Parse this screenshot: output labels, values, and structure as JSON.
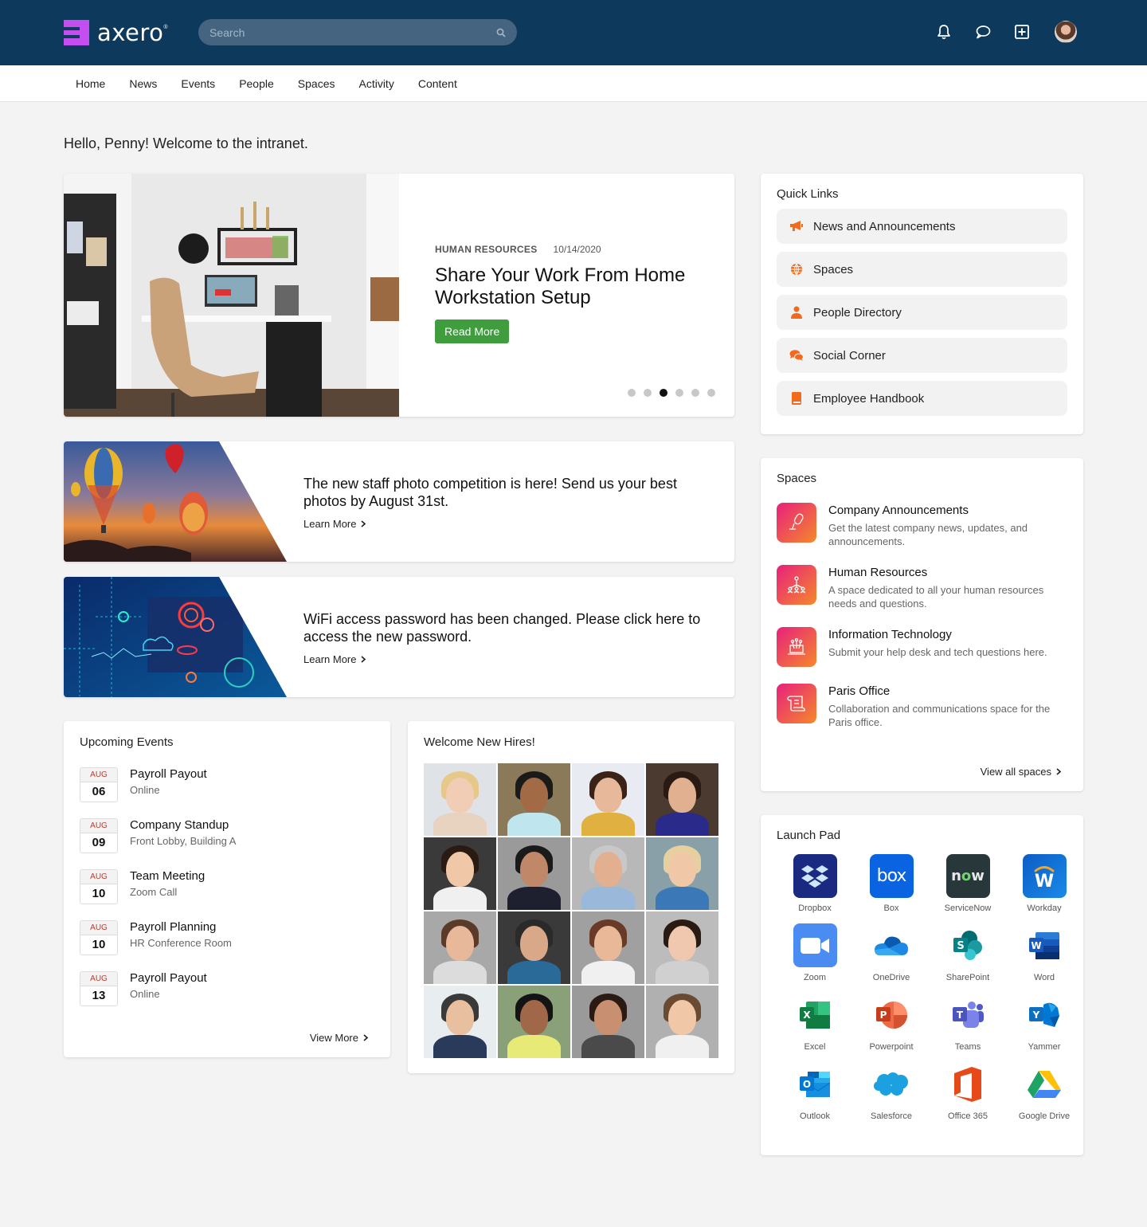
{
  "app": {
    "logo_text": "axero",
    "brand_color": "#c54ef0",
    "header_color": "#0d3a5c"
  },
  "search": {
    "placeholder": "Search",
    "value": ""
  },
  "header_icons": [
    "bell-icon",
    "chat-icon",
    "add-icon",
    "avatar"
  ],
  "nav": [
    {
      "label": "Home"
    },
    {
      "label": "News"
    },
    {
      "label": "Events"
    },
    {
      "label": "People"
    },
    {
      "label": "Spaces"
    },
    {
      "label": "Activity"
    },
    {
      "label": "Content"
    }
  ],
  "greeting": "Hello, Penny! Welcome to the intranet.",
  "hero": {
    "category": "HUMAN RESOURCES",
    "date": "10/14/2020",
    "title": "Share Your Work From Home Workstation Setup",
    "button": "Read More",
    "slide_count": 6,
    "active_slide": 3
  },
  "banners": [
    {
      "title": "The new staff photo competition is here! Send us your best photos by August 31st.",
      "link": "Learn More"
    },
    {
      "title": "WiFi access password has been changed. Please click here to access the new password.",
      "link": "Learn More"
    }
  ],
  "events": {
    "title": "Upcoming Events",
    "items": [
      {
        "month": "AUG",
        "day": "06",
        "title": "Payroll Payout",
        "location": "Online"
      },
      {
        "month": "AUG",
        "day": "09",
        "title": "Company Standup",
        "location": "Front Lobby, Building A"
      },
      {
        "month": "AUG",
        "day": "10",
        "title": "Team Meeting",
        "location": "Zoom Call"
      },
      {
        "month": "AUG",
        "day": "10",
        "title": "Payroll Planning",
        "location": "HR Conference Room"
      },
      {
        "month": "AUG",
        "day": "13",
        "title": "Payroll Payout",
        "location": "Online"
      }
    ],
    "view_more": "View More"
  },
  "new_hires": {
    "title": "Welcome New Hires!",
    "photo_count": 16
  },
  "quick_links": {
    "title": "Quick Links",
    "accent": "#f26b1d",
    "items": [
      {
        "label": "News and Announcements",
        "icon": "megaphone-icon"
      },
      {
        "label": "Spaces",
        "icon": "globe-icon"
      },
      {
        "label": "People Directory",
        "icon": "person-icon"
      },
      {
        "label": "Social Corner",
        "icon": "comments-icon"
      },
      {
        "label": "Employee Handbook",
        "icon": "book-icon"
      }
    ]
  },
  "spaces": {
    "title": "Spaces",
    "items": [
      {
        "name": "Company Announcements",
        "desc": "Get the latest company news, updates, and announcements.",
        "icon": "microphone-icon"
      },
      {
        "name": "Human Resources",
        "desc": "A space dedicated to all your human resources needs and questions.",
        "icon": "org-chart-icon"
      },
      {
        "name": "Information Technology",
        "desc": "Submit your help desk and tech questions here.",
        "icon": "laptop-icon"
      },
      {
        "name": "Paris Office",
        "desc": "Collaboration and communications space for the Paris office.",
        "icon": "scroll-icon"
      }
    ],
    "view_all": "View all spaces"
  },
  "launch_pad": {
    "title": "Launch Pad",
    "apps": [
      {
        "label": "Dropbox"
      },
      {
        "label": "Box"
      },
      {
        "label": "ServiceNow"
      },
      {
        "label": "Workday"
      },
      {
        "label": "Zoom"
      },
      {
        "label": "OneDrive"
      },
      {
        "label": "SharePoint"
      },
      {
        "label": "Word"
      },
      {
        "label": "Excel"
      },
      {
        "label": "Powerpoint"
      },
      {
        "label": "Teams"
      },
      {
        "label": "Yammer"
      },
      {
        "label": "Outlook"
      },
      {
        "label": "Salesforce"
      },
      {
        "label": "Office 365"
      },
      {
        "label": "Google Drive"
      }
    ]
  }
}
